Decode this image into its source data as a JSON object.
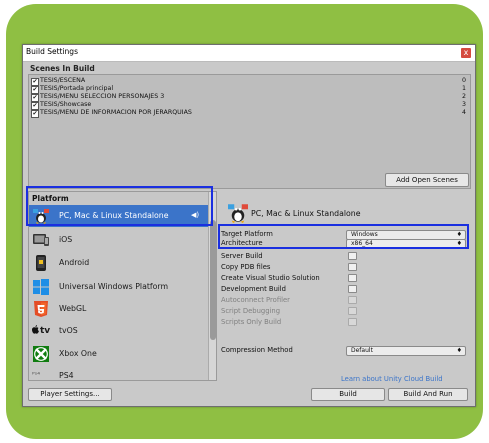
{
  "window": {
    "title": "Build Settings",
    "close_glyph": "x"
  },
  "scenes": {
    "header": "Scenes In Build",
    "items": [
      {
        "name": "TESIS/ESCENA",
        "index": "0",
        "checked": true
      },
      {
        "name": "TESIS/Portada principal",
        "index": "1",
        "checked": true
      },
      {
        "name": "TESIS/MENU SELECCION PERSONAJES 3",
        "index": "2",
        "checked": true
      },
      {
        "name": "TESIS/Showcase",
        "index": "3",
        "checked": true
      },
      {
        "name": "TESIS/MENU DE INFORMACION POR JERARQUIAS",
        "index": "4",
        "checked": true
      }
    ],
    "check_glyph": "✔",
    "add_open_scenes": "Add Open Scenes"
  },
  "platform": {
    "header": "Platform",
    "items": [
      {
        "label": "PC, Mac & Linux Standalone",
        "icon": "pc-mac-linux-icon",
        "selected": true
      },
      {
        "label": "iOS",
        "icon": "ios-device-icon",
        "selected": false
      },
      {
        "label": "Android",
        "icon": "android-icon",
        "selected": false
      },
      {
        "label": "Universal Windows Platform",
        "icon": "windows-icon",
        "selected": false
      },
      {
        "label": "WebGL",
        "icon": "html5-icon",
        "selected": false
      },
      {
        "label": "tvOS",
        "icon": "apple-tv-icon",
        "selected": false
      },
      {
        "label": "Xbox One",
        "icon": "xbox-icon",
        "selected": false
      },
      {
        "label": "PS4",
        "icon": "ps4-icon",
        "selected": false
      }
    ],
    "active_glyph": "◀)",
    "tv_prefix": "tv",
    "ps4_glyph": "ᴾˢ⁴"
  },
  "settings": {
    "title": "PC, Mac & Linux Standalone",
    "target_platform_label": "Target Platform",
    "target_platform_value": "Windows",
    "architecture_label": "Architecture",
    "architecture_value": "x86_64",
    "dropdown_glyph": "♦",
    "checkbox_options": [
      {
        "label": "Server Build",
        "disabled": false
      },
      {
        "label": "Copy PDB files",
        "disabled": false
      },
      {
        "label": "Create Visual Studio Solution",
        "disabled": false
      },
      {
        "label": "Development Build",
        "disabled": false
      },
      {
        "label": "Autoconnect Profiler",
        "disabled": true
      },
      {
        "label": "Script Debugging",
        "disabled": true
      },
      {
        "label": "Scripts Only Build",
        "disabled": true
      }
    ],
    "compression_label": "Compression Method",
    "compression_value": "Default"
  },
  "footer": {
    "cloud_link": "Learn about Unity Cloud Build",
    "player_settings": "Player Settings...",
    "build": "Build",
    "build_and_run": "Build And Run"
  },
  "colors": {
    "background_card": "#8fbf43",
    "selection": "#3b74c9",
    "highlight_box": "#1a2fe0",
    "link": "#3b74c9"
  }
}
